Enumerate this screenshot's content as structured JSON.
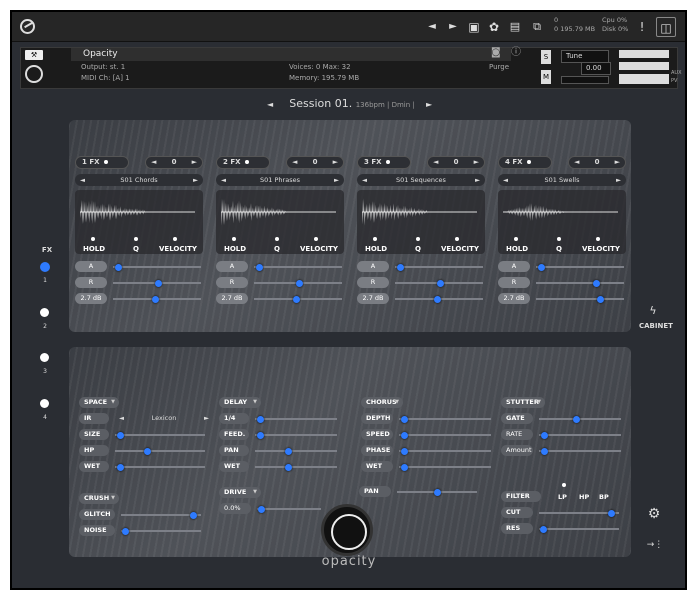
{
  "toolbar": {
    "prev": "◄",
    "next": "►",
    "disk_label": "0",
    "memory": "195.79 MB",
    "cpu_label": "Cpu",
    "cpu_val": "0%",
    "disk_lbl": "Disk",
    "disk_val": "0%",
    "warn": "!"
  },
  "header": {
    "instrument": "Opacity",
    "output_label": "Output:",
    "output_val": "st. 1",
    "midi_label": "MIDI Ch:",
    "midi_val": "[A] 1",
    "voices_label": "Voices:",
    "voices_val": "0",
    "max_label": "Max:",
    "max_val": "32",
    "memory_label": "Memory:",
    "memory_val": "195.79 MB",
    "purge": "Purge",
    "tune_label": "Tune",
    "tune_val": "0.00",
    "s_btn": "S",
    "m_btn": "M",
    "aux": "AUX",
    "pv": "PV"
  },
  "session": {
    "name": "Session 01.",
    "meta": "136bpm | Dmin |"
  },
  "slots": [
    {
      "num": "1",
      "fx": "FX",
      "count": "0",
      "preset": "S01 Chords",
      "hold": "HOLD",
      "q": "Q",
      "velocity": "VELOCITY",
      "a": "A",
      "r": "R",
      "vol": "2.7 dB",
      "a_pos": 0.02,
      "r_pos": 0.52,
      "vol_pos": 0.48
    },
    {
      "num": "2",
      "fx": "FX",
      "count": "0",
      "preset": "S01 Phrases",
      "hold": "HOLD",
      "q": "Q",
      "velocity": "VELOCITY",
      "a": "A",
      "r": "R",
      "vol": "2.7 dB",
      "a_pos": 0.02,
      "r_pos": 0.52,
      "vol_pos": 0.48
    },
    {
      "num": "3",
      "fx": "FX",
      "count": "0",
      "preset": "S01 Sequences",
      "hold": "HOLD",
      "q": "Q",
      "velocity": "VELOCITY",
      "a": "A",
      "r": "R",
      "vol": "2.7 dB",
      "a_pos": 0.02,
      "r_pos": 0.52,
      "vol_pos": 0.48
    },
    {
      "num": "4",
      "fx": "FX",
      "count": "0",
      "preset": "S01 Swells",
      "hold": "HOLD",
      "q": "Q",
      "velocity": "VELOCITY",
      "a": "A",
      "r": "R",
      "vol": "2.7 dB",
      "a_pos": 0.02,
      "r_pos": 0.7,
      "vol_pos": 0.75
    }
  ],
  "sidebar": {
    "fx": "FX",
    "n1": "1",
    "n2": "2",
    "n3": "3",
    "n4": "4"
  },
  "cabinet": "CABINET",
  "space": {
    "space": "SPACE",
    "ir": "IR",
    "ir_preset": "Lexicon",
    "size": "SIZE",
    "hp": "HP",
    "wet": "WET",
    "size_pos": 0.02,
    "hp_pos": 0.35,
    "wet_pos": 0.02
  },
  "delay": {
    "delay": "DELAY",
    "time": "1/4",
    "feed": "FEED.",
    "pan": "PAN",
    "wet": "WET",
    "time_pos": 0.02,
    "feed_pos": 0.02,
    "pan_pos": 0.4,
    "wet_pos": 0.4
  },
  "chorus": {
    "chorus": "CHORUS",
    "depth": "DEPTH",
    "speed": "SPEED",
    "phase": "PHASE",
    "wet": "WET",
    "pan": "PAN",
    "depth_pos": 0.02,
    "speed_pos": 0.02,
    "phase_pos": 0.02,
    "wet_pos": 0.02,
    "pan_pos": 0.5
  },
  "stutter": {
    "stutter": "STUTTER",
    "gate": "GATE",
    "rate": "RATE",
    "amount": "Amount",
    "gate_pos": 0.45,
    "rate_pos": 0.02,
    "amount_pos": 0.02
  },
  "lofi": {
    "crush": "CRUSH",
    "glitch": "GLITCH",
    "noise": "NOISE",
    "glitch_pos": 0.95,
    "noise_pos": 0.02
  },
  "drive": {
    "drive": "DRIVE",
    "amount": "0.0%",
    "amount_pos": 0.02
  },
  "filter": {
    "filter": "FILTER",
    "lp": "LP",
    "hp": "HP",
    "bp": "BP",
    "cut": "CUT",
    "res": "RES",
    "cut_pos": 0.95,
    "res_pos": 0.02
  },
  "brand": "opacity",
  "icons": {
    "gear": "gear-icon",
    "bolt": "bolt-icon",
    "export": "export-icon"
  }
}
